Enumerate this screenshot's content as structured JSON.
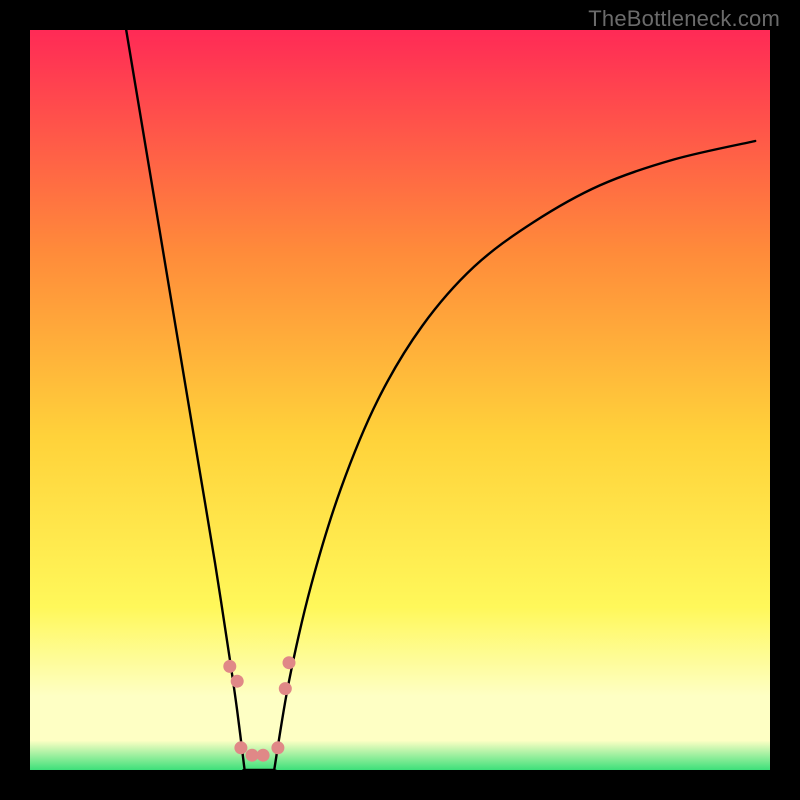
{
  "watermark": "TheBottleneck.com",
  "colors": {
    "bg": "#000000",
    "grad_top": "#ff2a56",
    "grad_mid1": "#ff8b3a",
    "grad_mid2": "#ffd23a",
    "grad_mid3": "#fff85a",
    "grad_lowglow": "#feffc4",
    "grad_bottom": "#3de07a",
    "curve": "#000000",
    "dot": "#e08887"
  },
  "chart_data": {
    "type": "line",
    "title": "",
    "xlabel": "",
    "ylabel": "",
    "xlim": [
      0,
      100
    ],
    "ylim": [
      0,
      100
    ],
    "series": [
      {
        "name": "left-branch",
        "x": [
          13,
          15,
          17,
          19,
          21,
          23,
          25,
          27,
          28,
          29
        ],
        "values": [
          100,
          88,
          76,
          64,
          52,
          40,
          28,
          15,
          8,
          0
        ]
      },
      {
        "name": "right-branch",
        "x": [
          33,
          35,
          38,
          42,
          47,
          53,
          60,
          68,
          77,
          87,
          98
        ],
        "values": [
          0,
          12,
          25,
          38,
          50,
          60,
          68,
          74,
          79,
          82.5,
          85
        ]
      }
    ],
    "flat_bottom": {
      "x_from": 29,
      "x_to": 33,
      "y": 0
    },
    "dots": [
      {
        "x": 27.0,
        "y": 14.0
      },
      {
        "x": 28.0,
        "y": 12.0
      },
      {
        "x": 28.5,
        "y": 3.0
      },
      {
        "x": 30.0,
        "y": 2.0
      },
      {
        "x": 31.5,
        "y": 2.0
      },
      {
        "x": 33.5,
        "y": 3.0
      },
      {
        "x": 34.5,
        "y": 11.0
      },
      {
        "x": 35.0,
        "y": 14.5
      }
    ]
  }
}
